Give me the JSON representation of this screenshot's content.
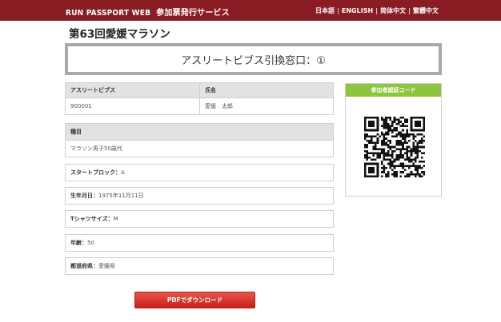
{
  "header": {
    "brand": "RUN PASSPORT WEB",
    "service": "参加票発行サービス",
    "languages": [
      "日本語",
      "ENGLISH",
      "简体中文",
      "繁體中文"
    ]
  },
  "page_title": "第63回愛媛マラソン",
  "window_label": "アスリートビブス引換窓口：①",
  "athlete_table": {
    "columns": [
      "アスリートビブス",
      "氏名"
    ],
    "row": [
      "900001",
      "愛媛　太郎"
    ]
  },
  "category": {
    "label": "種目",
    "value": "マラソン男子50歳代"
  },
  "fields": [
    {
      "label": "スタートブロック：",
      "value": "A"
    },
    {
      "label": "生年月日：",
      "value": "1975年11月11日"
    },
    {
      "label": "Tシャツサイズ：",
      "value": "M"
    },
    {
      "label": "年齢：",
      "value": "50"
    },
    {
      "label": "都道府県：",
      "value": "愛媛県"
    }
  ],
  "qr_panel": {
    "title": "参加者認証コード"
  },
  "download_button": "PDFでダウンロード",
  "colors": {
    "header_bg": "#8a1d24",
    "qr_header_bg": "#8cc63f",
    "button_bg": "#d9362d"
  }
}
